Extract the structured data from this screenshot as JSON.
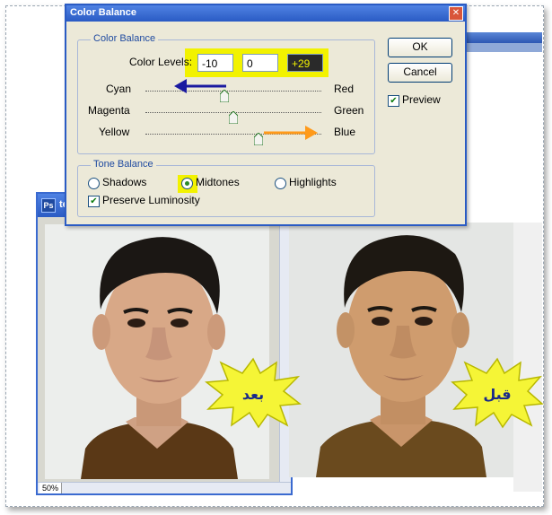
{
  "dialog": {
    "title": "Color Balance",
    "color_balance_group": "Color Balance",
    "color_levels_label": "Color Levels:",
    "levels": [
      "-10",
      "0",
      "+29"
    ],
    "sliders": [
      {
        "left": "Cyan",
        "right": "Red",
        "value": -10
      },
      {
        "left": "Magenta",
        "right": "Green",
        "value": 0
      },
      {
        "left": "Yellow",
        "right": "Blue",
        "value": 29
      }
    ],
    "slider_range": [
      -100,
      100
    ],
    "tone_group": "Tone Balance",
    "tones": [
      "Shadows",
      "Midtones",
      "Highlights"
    ],
    "selected_tone": "Midtones",
    "preserve_luminosity": "Preserve Luminosity",
    "ok": "OK",
    "cancel": "Cancel",
    "preview": "Preview"
  },
  "photo_window": {
    "title": "te",
    "zoom": "50%"
  },
  "labels": {
    "after": "بعد",
    "before": "قبل"
  },
  "colors": {
    "highlight": "#f2f200",
    "starburst": "#f5f536",
    "arrow_left": "#1a1aa0",
    "arrow_right": "#ff9a1a",
    "label_text": "#1a2a8a"
  }
}
